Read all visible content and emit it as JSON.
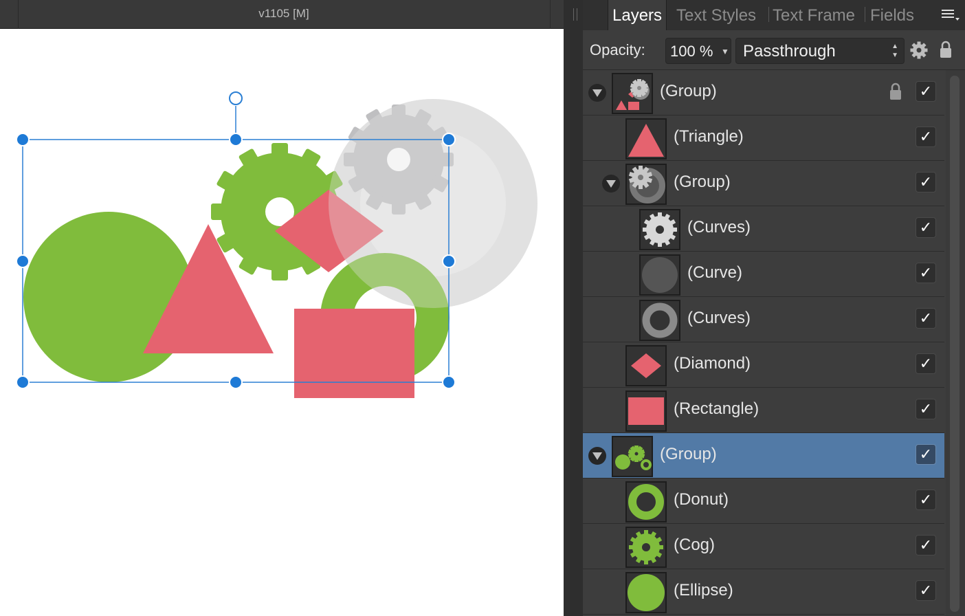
{
  "document": {
    "title": "v1105   [M]"
  },
  "panel": {
    "tabs": [
      {
        "label": "Layers",
        "active": true
      },
      {
        "label": "Text Styles",
        "active": false
      },
      {
        "label": "Text Frame",
        "active": false
      },
      {
        "label": "Fields",
        "active": false
      }
    ],
    "opacity_label": "Opacity:",
    "opacity_value": "100 %",
    "blend_mode": "Passthrough",
    "icons": {
      "menu": "panel-menu-icon",
      "settings": "gear-icon",
      "lock": "lock-icon"
    }
  },
  "layers": [
    {
      "name": "(Group)",
      "depth": 0,
      "expanded": true,
      "locked": true,
      "visible": true,
      "selected": false,
      "thumb": "red-group"
    },
    {
      "name": "(Triangle)",
      "depth": 1,
      "visible": true,
      "selected": false,
      "thumb": "triangle"
    },
    {
      "name": "(Group)",
      "depth": 1,
      "expanded": true,
      "visible": true,
      "selected": false,
      "thumb": "grey-group"
    },
    {
      "name": "(Curves)",
      "depth": 2,
      "visible": true,
      "selected": false,
      "thumb": "grey-cog"
    },
    {
      "name": "(Curve)",
      "depth": 2,
      "visible": true,
      "selected": false,
      "thumb": "grey-circle"
    },
    {
      "name": "(Curves)",
      "depth": 2,
      "visible": true,
      "selected": false,
      "thumb": "grey-donut"
    },
    {
      "name": "(Diamond)",
      "depth": 1,
      "visible": true,
      "selected": false,
      "thumb": "diamond"
    },
    {
      "name": "(Rectangle)",
      "depth": 1,
      "visible": true,
      "selected": false,
      "thumb": "rectangle"
    },
    {
      "name": "(Group)",
      "depth": 0,
      "expanded": true,
      "visible": true,
      "selected": true,
      "thumb": "green-group"
    },
    {
      "name": "(Donut)",
      "depth": 1,
      "visible": true,
      "selected": false,
      "thumb": "green-donut"
    },
    {
      "name": "(Cog)",
      "depth": 1,
      "visible": true,
      "selected": false,
      "thumb": "green-cog"
    },
    {
      "name": "(Ellipse)",
      "depth": 1,
      "visible": true,
      "selected": false,
      "thumb": "green-ellipse"
    }
  ],
  "colors": {
    "green": "#80bc3c",
    "red": "#e5636f",
    "grey_cog": "#bdbdbf",
    "grey_light": "#ececec",
    "grey_mid": "#dcdcdc",
    "selection_blue": "#1e7ad6",
    "selected_row": "#527aa6"
  },
  "visibility_glyph": "✓"
}
